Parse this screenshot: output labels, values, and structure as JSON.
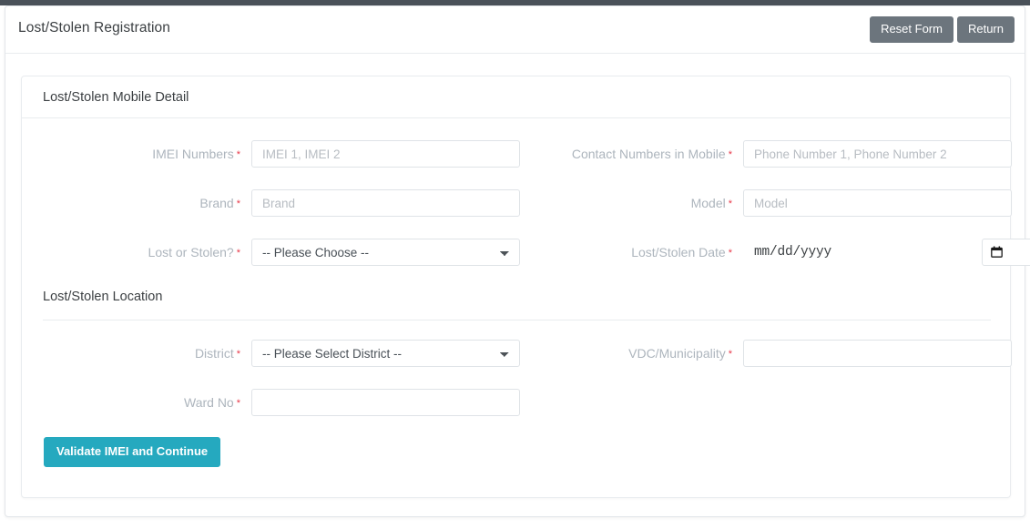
{
  "page": {
    "title": "Lost/Stolen Registration"
  },
  "header": {
    "title": "Lost/Stolen Registration",
    "buttons": {
      "reset": "Reset Form",
      "return": "Return"
    }
  },
  "panel": {
    "title": "Lost/Stolen Mobile Detail",
    "location_section_title": "Lost/Stolen Location"
  },
  "fields": {
    "imei": {
      "label": "IMEI Numbers",
      "required": "*",
      "placeholder": "IMEI 1, IMEI 2",
      "value": ""
    },
    "contact": {
      "label": "Contact Numbers in Mobile",
      "required": "*",
      "placeholder": "Phone Number 1, Phone Number 2",
      "value": ""
    },
    "brand": {
      "label": "Brand",
      "required": "*",
      "placeholder": "Brand",
      "value": ""
    },
    "model": {
      "label": "Model",
      "required": "*",
      "placeholder": "Model",
      "value": ""
    },
    "lost_or_stolen": {
      "label": "Lost or Stolen?",
      "required": "*",
      "selected": "-- Please Choose --"
    },
    "date": {
      "label": "Lost/Stolen Date",
      "required": "*",
      "placeholder": "mm/dd/yyyy",
      "value": ""
    },
    "district": {
      "label": "District",
      "required": "*",
      "selected": "-- Please Select District --"
    },
    "vdc": {
      "label": "VDC/Municipality",
      "required": "*",
      "placeholder": "",
      "value": ""
    },
    "ward": {
      "label": "Ward No",
      "required": "*",
      "placeholder": "",
      "value": ""
    }
  },
  "actions": {
    "validate": "Validate IMEI and Continue"
  },
  "colors": {
    "primary": "#25a9bf",
    "secondary": "#6c757d",
    "required": "#e8394a",
    "label": "#adb5bd",
    "border": "#dfe3e7",
    "topbar": "#4a5159"
  }
}
